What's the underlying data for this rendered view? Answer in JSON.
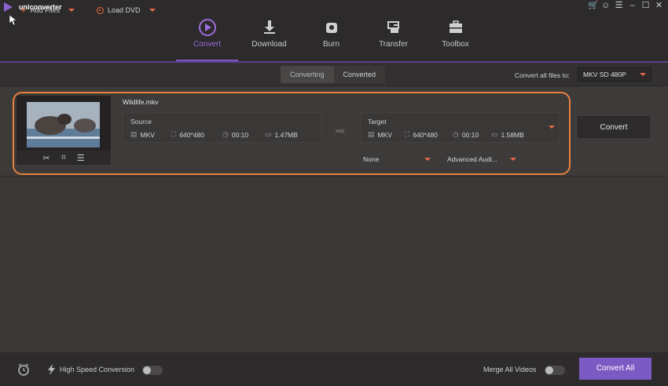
{
  "app": {
    "title": "uniconverter"
  },
  "nav": [
    {
      "label": "Convert",
      "icon": "convert-icon"
    },
    {
      "label": "Download",
      "icon": "download-icon"
    },
    {
      "label": "Burn",
      "icon": "burn-icon"
    },
    {
      "label": "Transfer",
      "icon": "transfer-icon"
    },
    {
      "label": "Toolbox",
      "icon": "toolbox-icon"
    }
  ],
  "toolbar": {
    "add_files": "Add Files",
    "load_dvd": "Load DVD",
    "tab_converting": "Converting",
    "tab_converted": "Converted",
    "convert_all_to_label": "Convert all files to:",
    "convert_all_to_value": "MKV SD 480P"
  },
  "file": {
    "name": "Wildlife.mkv",
    "source": {
      "title": "Source",
      "format": "MKV",
      "resolution": "640*480",
      "duration": "00:10",
      "size": "1.47MB"
    },
    "target": {
      "title": "Target",
      "format": "MKV",
      "resolution": "640*480",
      "duration": "00:10",
      "size": "1.58MB"
    },
    "subtitle_select": "None",
    "audio_select": "Advanced Audi...",
    "convert_button": "Convert"
  },
  "bottom": {
    "high_speed": "High Speed Conversion",
    "merge_all": "Merge All Videos",
    "convert_all": "Convert All"
  },
  "colors": {
    "accent": "#7c5ac3",
    "highlight": "#e8813c",
    "orange_icon": "#e8674a"
  }
}
